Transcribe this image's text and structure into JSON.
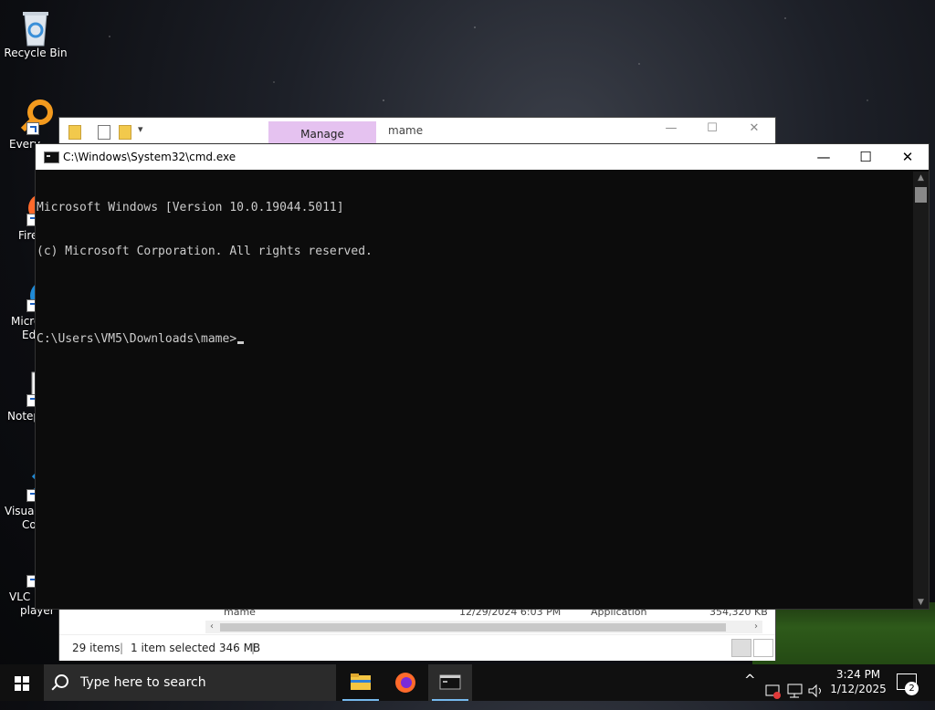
{
  "desktop": {
    "icons": [
      {
        "label": "Recycle Bin"
      },
      {
        "label": "Every"
      },
      {
        "label": "Fire"
      },
      {
        "label": "Micro",
        "label2": "Ed"
      },
      {
        "label": "Notep"
      },
      {
        "label": "Visual",
        "label2": "Co"
      },
      {
        "label": "VLC m",
        "label2": "player"
      }
    ]
  },
  "explorer": {
    "ribbon_tab": "Manage",
    "title": "mame",
    "controls": {
      "minimize": "—",
      "maximize": "☐",
      "close": "✕"
    },
    "row": {
      "name": "mame",
      "date": "12/29/2024 6:03 PM",
      "type": "Application",
      "size": "354,320 KB"
    },
    "status": {
      "items": "29 items",
      "selected": "1 item selected  346 MB"
    }
  },
  "cmd": {
    "title": "C:\\Windows\\System32\\cmd.exe",
    "controls": {
      "minimize": "—",
      "maximize": "☐",
      "close": "✕"
    },
    "lines": [
      "Microsoft Windows [Version 10.0.19044.5011]",
      "(c) Microsoft Corporation. All rights reserved.",
      "",
      "C:\\Users\\VM5\\Downloads\\mame>"
    ]
  },
  "taskbar": {
    "search_placeholder": "Type here to search",
    "time": "3:24 PM",
    "date": "1/12/2025",
    "notification_count": "2",
    "tray_chevron": "^"
  },
  "colors": {
    "accent": "#76b9ed",
    "manage_tab": "#e5c2f0",
    "console_bg": "#0c0c0c",
    "console_fg": "#cccccc"
  }
}
